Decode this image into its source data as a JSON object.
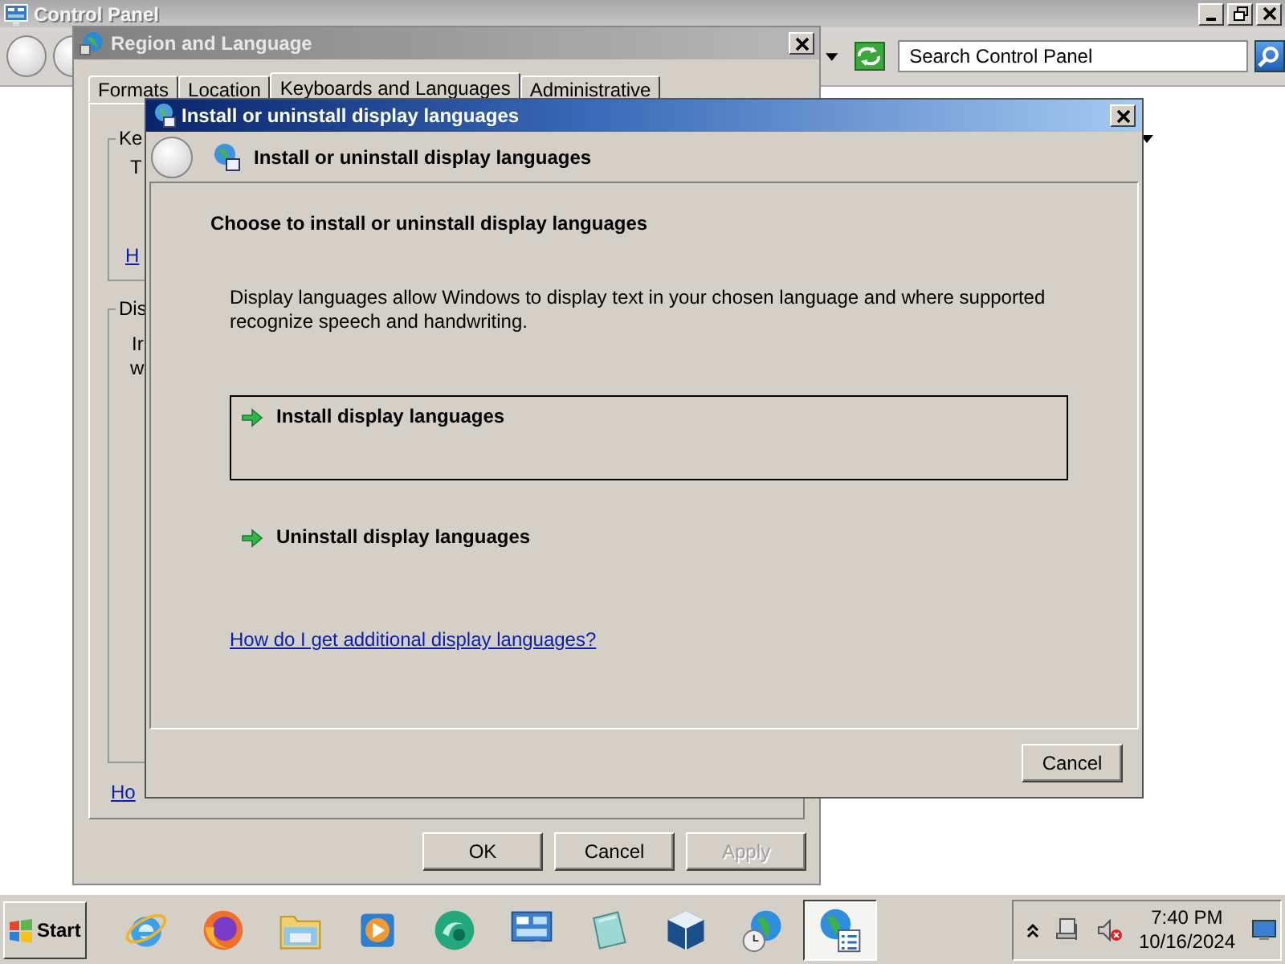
{
  "control_panel": {
    "title": "Control Panel",
    "search": {
      "placeholder": "Search Control Panel"
    }
  },
  "region_dialog": {
    "title": "Region and Language",
    "tabs": [
      {
        "label": "Formats",
        "selected": false
      },
      {
        "label": "Location",
        "selected": false
      },
      {
        "label": "Keyboards and Languages",
        "selected": true
      },
      {
        "label": "Administrative",
        "selected": false
      }
    ],
    "groups": [
      {
        "label": "Ke",
        "lines": [
          "T"
        ],
        "link": "H"
      },
      {
        "label": "Dis",
        "lines": [
          "Ir",
          "w"
        ]
      }
    ],
    "help_link": "Ho",
    "buttons": [
      {
        "label": "OK",
        "disabled": false
      },
      {
        "label": "Cancel",
        "disabled": false
      },
      {
        "label": "Apply",
        "disabled": true
      }
    ]
  },
  "install_dialog": {
    "title": "Install or uninstall display languages",
    "header": "Install or uninstall display languages",
    "heading": "Choose to install or uninstall display languages",
    "description": "Display languages allow Windows to display text in your chosen language and where supported recognize speech and handwriting.",
    "options": [
      {
        "label": "Install display languages",
        "selected": true
      },
      {
        "label": "Uninstall display languages",
        "selected": false
      }
    ],
    "help_link": "How do I get additional display languages?",
    "buttons": [
      {
        "label": "Cancel"
      }
    ]
  },
  "taskbar": {
    "start": "Start",
    "apps": [
      {
        "kind": "ie",
        "active": false
      },
      {
        "kind": "firefox",
        "active": false
      },
      {
        "kind": "explorer",
        "active": false
      },
      {
        "kind": "media",
        "active": false
      },
      {
        "kind": "swirl",
        "active": false
      },
      {
        "kind": "control-panel",
        "active": false
      },
      {
        "kind": "notepad",
        "active": false
      },
      {
        "kind": "virtualbox",
        "active": false
      },
      {
        "kind": "globe-clock",
        "active": false
      },
      {
        "kind": "globe-list",
        "active": true
      }
    ],
    "clock": {
      "time": "7:40 PM",
      "date": "10/16/2024"
    }
  }
}
